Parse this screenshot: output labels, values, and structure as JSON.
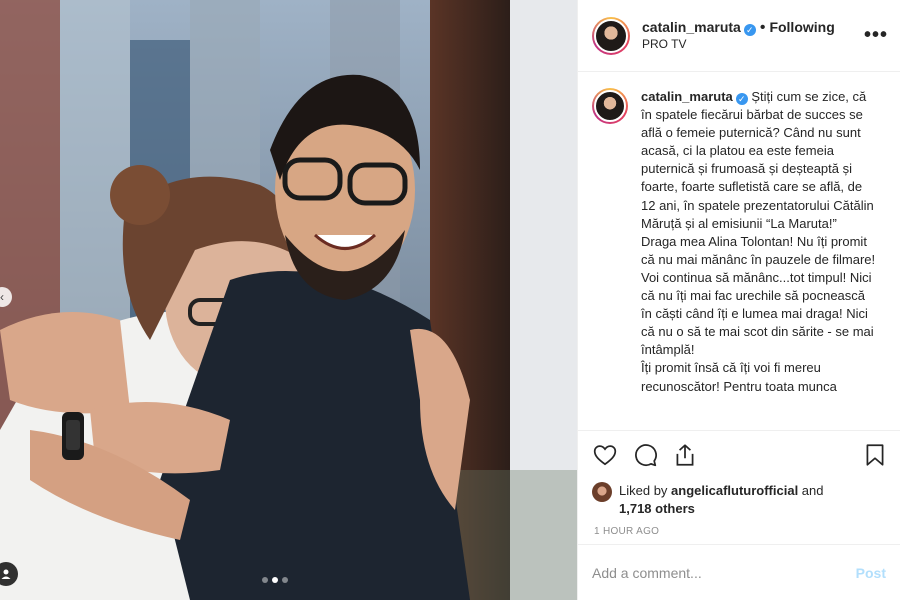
{
  "post": {
    "username": "catalin_maruta",
    "verified": true,
    "follow_separator": "•",
    "follow_status": "Following",
    "location": "PRO TV",
    "more_icon": "more-options-icon",
    "more_label": "•••"
  },
  "caption": {
    "username": "catalin_maruta",
    "text": "Știți cum se zice, că în spatele fiecărui bărbat de succes se află o femeie puternică? Când nu sunt acasă, ci la platou ea este femeia puternică și frumoasă și deșteaptă și foarte, foarte sufletistă care se află, de 12 ani, în spatele prezentatorului Cătălin Măruță și al emisiunii “La Maruta!”\nDraga mea Alina Tolontan! Nu îți promit că nu mai mănânc în pauzele de filmare! Voi continua să mănânc...tot timpul! Nici că nu îți mai fac urechile să pocnească în căști când îți e lumea mai draga! Nici că nu o să te mai scot din sărite - se mai întâmplă!\nÎți promit însă că îți voi fi mereu recunoscător! Pentru toata munca"
  },
  "actions": {
    "like_icon": "heart-icon",
    "comment_icon": "comment-icon",
    "share_icon": "share-icon",
    "save_icon": "bookmark-icon"
  },
  "likes": {
    "prefix": "Liked by ",
    "liker": "angelicafluturofficial",
    "middle": " and",
    "others": "1,718 others"
  },
  "timestamp": "1 HOUR AGO",
  "comment_box": {
    "placeholder": "Add a comment...",
    "post_label": "Post"
  },
  "carousel": {
    "count": 3,
    "active_index": 1
  },
  "colors": {
    "verified": "#3897f0",
    "post_disabled": "#b2dffc",
    "muted": "#8e8e8e",
    "border": "#efefef"
  }
}
